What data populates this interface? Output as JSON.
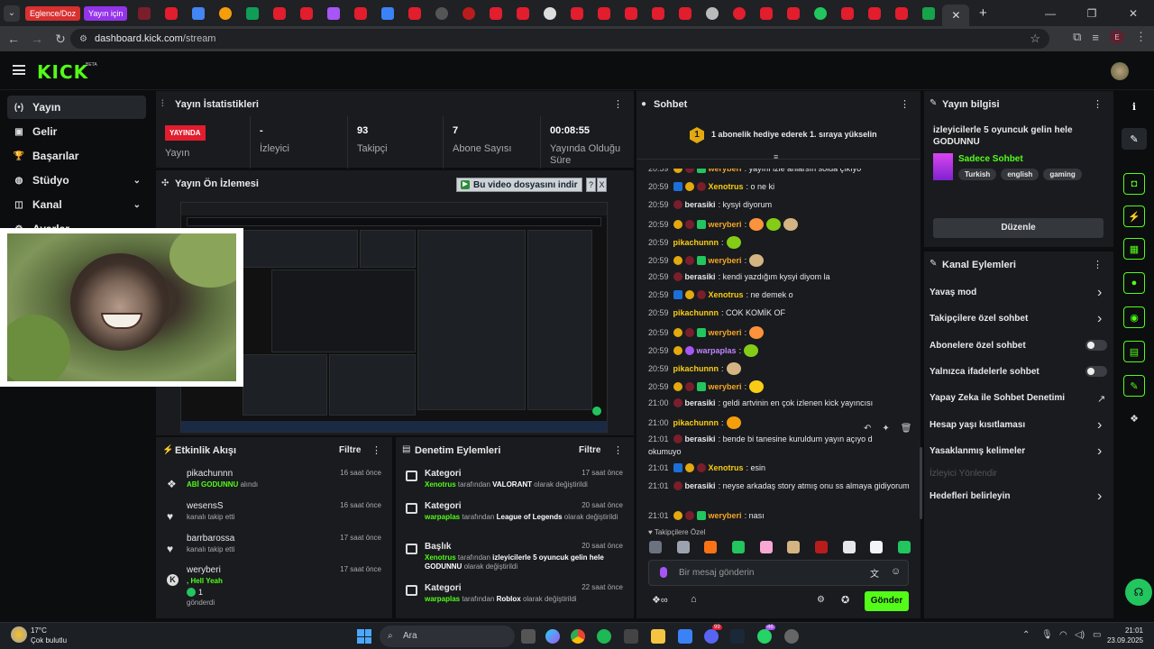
{
  "browser": {
    "folder_tabs": [
      "Eglence/Doz",
      "Yayın için"
    ],
    "url_domain": "dashboard.kick.com",
    "url_path": "/stream",
    "profile_letter": "E"
  },
  "kick": {
    "logo": "KICK",
    "beta": "BETA"
  },
  "sidebar": {
    "items": [
      {
        "label": "Yayın",
        "icon": "(•)"
      },
      {
        "label": "Gelir",
        "icon": "▣"
      },
      {
        "label": "Başarılar",
        "icon": "🏆"
      },
      {
        "label": "Stüdyo",
        "icon": "◍"
      },
      {
        "label": "Kanal",
        "icon": "◫"
      },
      {
        "label": "Ayarlar",
        "icon": "⚙"
      }
    ]
  },
  "stats": {
    "title": "Yayın İstatistikleri",
    "live_badge": "YAYINDA",
    "live_label": "Yayın",
    "viewers_value": "-",
    "viewers_label": "İzleyici",
    "followers_value": "93",
    "followers_label": "Takipçi",
    "subs_value": "7",
    "subs_label": "Abone Sayısı",
    "uptime_value": "00:08:55",
    "uptime_label": "Yayında Olduğu Süre"
  },
  "preview": {
    "title": "Yayın Ön İzlemesi",
    "download_label": "Bu video dosyasını indir",
    "help": "?",
    "close": "X"
  },
  "activity": {
    "title": "Etkinlik Akışı",
    "filter": "Filtre",
    "items": [
      {
        "name": "pikachunnn",
        "highlight": "ABİ GODUNNU",
        "rest": " alındı",
        "time": "16 saat önce"
      },
      {
        "name": "wesensS",
        "highlight": "",
        "rest": "kanalı takip etti",
        "time": "16 saat önce"
      },
      {
        "name": "barrbarossa",
        "highlight": "",
        "rest": "kanalı takip etti",
        "time": "17 saat önce"
      },
      {
        "name": "weryberi",
        "highlight": ", Hell Yeah",
        "rest": "gönderdi",
        "extra": "1",
        "time": "17 saat önce"
      }
    ]
  },
  "moderation": {
    "title": "Denetim Eylemleri",
    "filter": "Filtre",
    "items": [
      {
        "title": "Kategori",
        "user": "Xenotrus",
        "mid": " tarafından ",
        "value": "VALORANT",
        "end": " olarak değiştirildi",
        "time": "17 saat önce"
      },
      {
        "title": "Kategori",
        "user": "warpaplas",
        "mid": " tarafından ",
        "value": "League of Legends",
        "end": " olarak değiştirildi",
        "time": "20 saat önce"
      },
      {
        "title": "Başlık",
        "user": "Xenotrus",
        "mid": " tarafından ",
        "value": "izleyicilerle 5 oyuncuk gelin hele GODUNNU",
        "end": " olarak değiştirildi",
        "time": "20 saat önce"
      },
      {
        "title": "Kategori",
        "user": "warpaplas",
        "mid": " tarafından ",
        "value": "Roblox",
        "end": " olarak değiştirildi",
        "time": "22 saat önce"
      }
    ]
  },
  "chat": {
    "title": "Sohbet",
    "gift_number": "1",
    "gift_text": "1 abonelik hediye ederek 1. sıraya yükselin",
    "messages": [
      {
        "time": "20:59",
        "user": "weryberi",
        "text": ": yayını izle anlarsın solda çıkıyo"
      },
      {
        "time": "20:59",
        "user": "Xenotrus",
        "text": ": o ne ki"
      },
      {
        "time": "20:59",
        "user": "berasiki",
        "text": ": kysyi diyorum"
      },
      {
        "time": "20:59",
        "user": "weryberi",
        "text": ":"
      },
      {
        "time": "20:59",
        "user": "pikachunnn",
        "text": ":"
      },
      {
        "time": "20:59",
        "user": "weryberi",
        "text": ":"
      },
      {
        "time": "20:59",
        "user": "berasiki",
        "text": ": kendi yazdığım kysyi diyom la"
      },
      {
        "time": "20:59",
        "user": "Xenotrus",
        "text": ": ne demek o"
      },
      {
        "time": "20:59",
        "user": "pikachunnn",
        "text": ": COK KOMİK OF"
      },
      {
        "time": "20:59",
        "user": "weryberi",
        "text": ":"
      },
      {
        "time": "20:59",
        "user": "warpaplas",
        "text": ":"
      },
      {
        "time": "20:59",
        "user": "pikachunnn",
        "text": ":"
      },
      {
        "time": "20:59",
        "user": "weryberi",
        "text": ":"
      },
      {
        "time": "21:00",
        "user": "berasiki",
        "text": ": geldi artvinin en çok izlenen kick yayıncısı"
      },
      {
        "time": "21:00",
        "user": "pikachunnn",
        "text": ":"
      },
      {
        "time": "21:01",
        "user": "berasiki",
        "text": ": bende bi tanesine kuruldum yayın açıyo d",
        "cont": "okumuyo"
      },
      {
        "time": "21:01",
        "user": "Xenotrus",
        "text": ": esin"
      },
      {
        "time": "21:01",
        "user": "berasiki",
        "text": ": neyse arkadaş story atmış onu ss almaya gidiyorum"
      },
      {
        "time": "21:01",
        "user": "weryberi",
        "text": ": nası"
      }
    ],
    "followers_only": "Takipçilere Özel",
    "input_placeholder": "Bir mesaj gönderin",
    "send": "Gönder"
  },
  "stream_info": {
    "title": "Yayın bilgisi",
    "stream_title": "izleyicilerle 5 oyuncuk gelin hele GODUNNU",
    "category": "Sadece Sohbet",
    "tags": [
      "Turkish",
      "english",
      "gaming"
    ],
    "edit": "Düzenle"
  },
  "channel_actions": {
    "title": "Kanal Eylemleri",
    "items": [
      {
        "label": "Yavaş mod",
        "kind": "arrow"
      },
      {
        "label": "Takipçilere özel sohbet",
        "kind": "arrow"
      },
      {
        "label": "Abonelere özel sohbet",
        "kind": "toggle"
      },
      {
        "label": "Yalnızca ifadelerle sohbet",
        "kind": "toggle"
      },
      {
        "label": "Yapay Zeka ile Sohbet Denetimi",
        "kind": "external"
      },
      {
        "label": "Hesap yaşı kısıtlaması",
        "kind": "arrow"
      },
      {
        "label": "Yasaklanmış kelimeler",
        "kind": "arrow"
      },
      {
        "label": "İzleyici Yönlendir",
        "kind": "disabled"
      },
      {
        "label": "Hedefleri belirleyin",
        "kind": "arrow"
      }
    ]
  },
  "taskbar": {
    "weather_temp": "17°C",
    "weather_desc": "Çok bulutlu",
    "search": "Ara",
    "time": "21:01",
    "date": "23.09.2025",
    "badges": [
      "99",
      "46"
    ]
  },
  "colors": {
    "kick_green": "#53fc18",
    "live_red": "#e11d2e",
    "panel": "#191b1f"
  }
}
